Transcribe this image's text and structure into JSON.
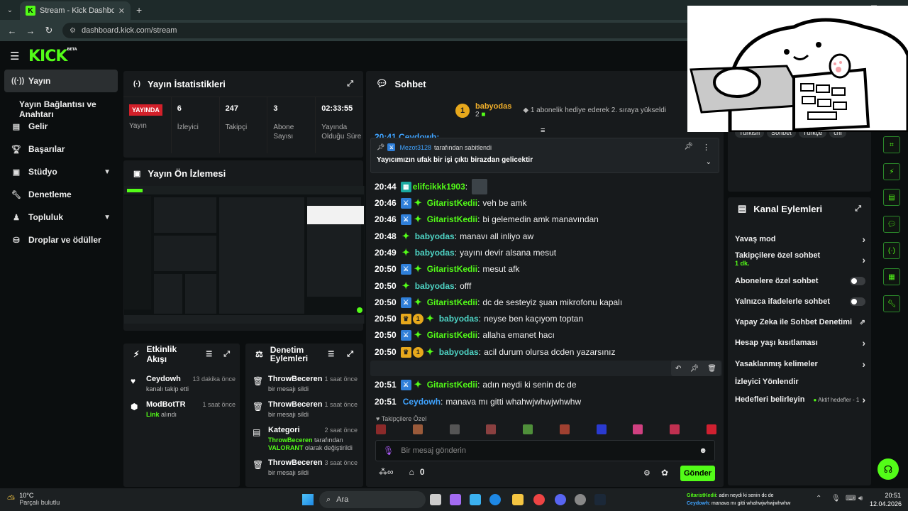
{
  "browser": {
    "tab_title": "Stream - Kick Dashboard",
    "url": "dashboard.kick.com/stream"
  },
  "brand": {
    "logo": "KICK",
    "beta": "BETA"
  },
  "sidebar": {
    "items": [
      {
        "label": "Yayın",
        "icon": "broadcast-icon"
      },
      {
        "label": "Yayın Bağlantısı ve Anahtarı",
        "icon": ""
      },
      {
        "label": "Gelir",
        "icon": "revenue-icon"
      },
      {
        "label": "Başarılar",
        "icon": "trophy-icon"
      },
      {
        "label": "Stüdyo",
        "icon": "studio-icon"
      },
      {
        "label": "Denetleme",
        "icon": "wrench-icon"
      },
      {
        "label": "Topluluk",
        "icon": "community-icon"
      },
      {
        "label": "Droplar ve ödüller",
        "icon": "drops-icon"
      }
    ]
  },
  "stats": {
    "title": "Yayın İstatistikleri",
    "live_badge": "YAYINDA",
    "cells": [
      {
        "value": "",
        "label": "Yayın"
      },
      {
        "value": "6",
        "label": "İzleyici"
      },
      {
        "value": "247",
        "label": "Takipçi"
      },
      {
        "value": "3",
        "label": "Abone Sayısı"
      },
      {
        "value": "02:33:55",
        "label": "Yayında Olduğu Süre"
      }
    ]
  },
  "preview": {
    "title": "Yayın Ön İzlemesi"
  },
  "activity": {
    "title": "Etkinlik Akışı",
    "items": [
      {
        "name": "Ceydowh",
        "desc": "kanalı takip etti",
        "time": "13 dakika önce",
        "icon": "heart-icon"
      },
      {
        "name": "ModBotTR",
        "desc_link": "Link",
        "desc": "alındı",
        "time": "1 saat önce",
        "icon": "gift-icon"
      }
    ]
  },
  "moderation": {
    "title": "Denetim Eylemleri",
    "items": [
      {
        "name": "ThrowBeceren",
        "desc": "bir mesajı sildi",
        "time": "1 saat önce",
        "icon": "trash-icon"
      },
      {
        "name": "ThrowBeceren",
        "desc": "bir mesajı sildi",
        "time": "1 saat önce",
        "icon": "trash-icon"
      },
      {
        "name": "Kategori",
        "desc_user": "ThrowBeceren",
        "desc_mid": "tarafından",
        "desc_game": "VALORANT",
        "desc_end": "olarak değiştirildi",
        "time": "2 saat önce",
        "icon": "category-icon"
      },
      {
        "name": "ThrowBeceren",
        "desc": "bir mesajı sildi",
        "time": "3 saat önce",
        "icon": "trash-icon"
      }
    ]
  },
  "chat": {
    "title": "Sohbet",
    "gift_user": "babyodas",
    "gift_count": "2",
    "gift_text": "1 abonelik hediye ederek 2. sıraya yükseldi",
    "top_partial": "20:41 Ceydowh:",
    "pinned_by": "Mezot3128",
    "pinned_suffix": "tarafından sabitlendi",
    "pinned_text": "Yayıcımızın ufak bir işi çıktı birazdan gelicektir",
    "messages": [
      {
        "time": "20:44",
        "user": "elifcikkk1903",
        "text": "",
        "style": "u-green",
        "badges": [
          "gift"
        ]
      },
      {
        "time": "20:46",
        "user": "GitaristKedii",
        "text": "veh be amk",
        "style": "u-green",
        "badges": [
          "mod",
          "vip"
        ]
      },
      {
        "time": "20:46",
        "user": "GitaristKedii",
        "text": "bi gelemedin amk manavından",
        "style": "u-green",
        "badges": [
          "mod",
          "vip"
        ]
      },
      {
        "time": "20:48",
        "user": "babyodas",
        "text": "manavı all inliyo aw",
        "style": "u-teal",
        "badges": [
          "vip"
        ]
      },
      {
        "time": "20:49",
        "user": "babyodas",
        "text": "yayını devir alsana mesut",
        "style": "u-teal",
        "badges": [
          "vip"
        ]
      },
      {
        "time": "20:50",
        "user": "GitaristKedii",
        "text": "mesut afk",
        "style": "u-green",
        "badges": [
          "mod",
          "vip"
        ]
      },
      {
        "time": "20:50",
        "user": "babyodas",
        "text": "offf",
        "style": "u-teal",
        "badges": [
          "vip"
        ]
      },
      {
        "time": "20:50",
        "user": "GitaristKedii",
        "text": "dc de sesteyiz şuan mikrofonu kapalı",
        "style": "u-green",
        "badges": [
          "mod",
          "vip"
        ]
      },
      {
        "time": "20:50",
        "user": "babyodas",
        "text": "neyse ben kaçıyom toptan",
        "style": "u-teal",
        "badges": [
          "crown",
          "sub",
          "vip"
        ]
      },
      {
        "time": "20:50",
        "user": "GitaristKedii",
        "text": "allaha emanet hacı",
        "style": "u-green",
        "badges": [
          "mod",
          "vip"
        ]
      },
      {
        "time": "20:50",
        "user": "babyodas",
        "text": "acil durum olursa dcden yazarsınız",
        "style": "u-teal",
        "badges": [
          "crown",
          "sub",
          "vip"
        ]
      },
      {
        "time": "20:50",
        "user": "GitaristKedii",
        "text": "tammamdır",
        "style": "u-green",
        "badges": [
          "mod",
          "vip"
        ]
      },
      {
        "time": "20:51",
        "user": "GitaristKedii",
        "text": "adın neydi ki senin dc de",
        "style": "u-green",
        "badges": [
          "mod",
          "vip"
        ]
      },
      {
        "time": "20:51",
        "user": "Ceydowh",
        "text": "manava mı gitti whahwjwhwjwhwhw",
        "style": "u-blue",
        "badges": []
      }
    ],
    "followers_label": "Takipçilere Özel",
    "input_placeholder": "Bir mesaj gönderin",
    "points": "0",
    "send_label": "Gönder"
  },
  "stream_info": {
    "tags": [
      "Turkish",
      "Sohbet",
      "Türkçe",
      "chi"
    ]
  },
  "channel_actions": {
    "title": "Kanal Eylemleri",
    "items": [
      {
        "label": "Yavaş mod",
        "control": "arrow"
      },
      {
        "label": "Takipçilere özel sohbet",
        "sub": "1 dk.",
        "control": "arrow"
      },
      {
        "label": "Abonelere özel sohbet",
        "control": "toggle"
      },
      {
        "label": "Yalnızca ifadelerle sohbet",
        "control": "toggle"
      },
      {
        "label": "Yapay Zeka ile Sohbet Denetimi",
        "control": "external"
      },
      {
        "label": "Hesap yaşı kısıtlaması",
        "control": "arrow"
      },
      {
        "label": "Yasaklanmış kelimeler",
        "control": "arrow"
      },
      {
        "label": "İzleyici Yönlendir",
        "control": "none"
      },
      {
        "label": "Hedefleri belirleyin",
        "status": "Aktif hedefler - 1",
        "control": "arrow"
      }
    ]
  },
  "taskbar": {
    "weather_temp": "10°C",
    "weather_desc": "Parçalı bulutlu",
    "search": "Ara",
    "time": "20:51",
    "date": "12.04.2026",
    "overlay": [
      {
        "user": "GitaristKedii",
        "text": "adın neydi ki senin dc de"
      },
      {
        "user": "Ceydowh",
        "text": "manava mı gitti whahwjwhwjwhwhw"
      }
    ]
  }
}
